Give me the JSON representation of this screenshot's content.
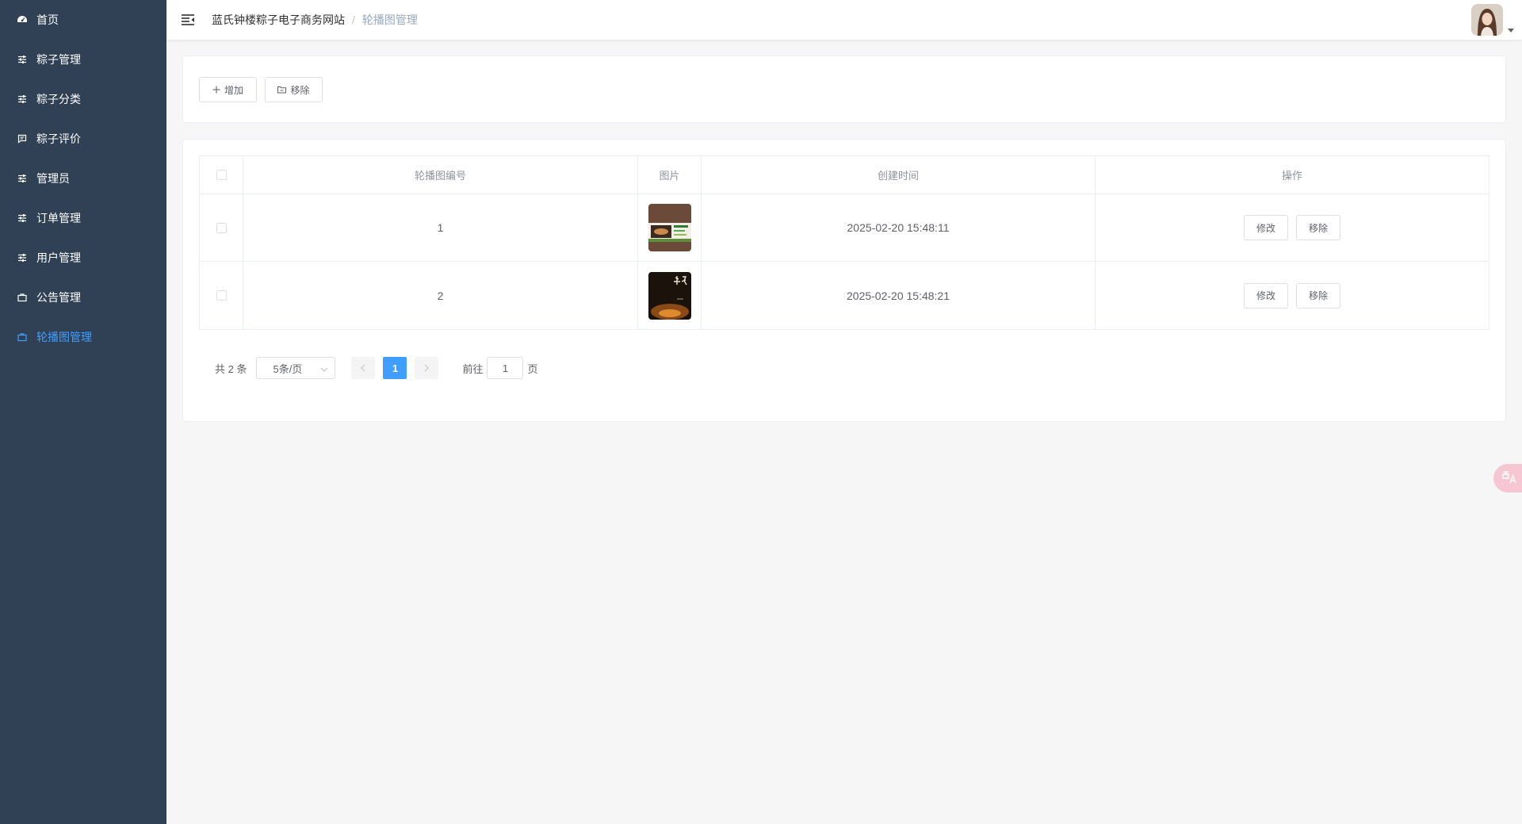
{
  "sidebar": {
    "items": [
      {
        "label": "首页",
        "icon": "dashboard-icon",
        "active": false
      },
      {
        "label": "粽子管理",
        "icon": "sliders-icon",
        "active": false
      },
      {
        "label": "粽子分类",
        "icon": "sliders-icon",
        "active": false
      },
      {
        "label": "粽子评价",
        "icon": "comment-icon",
        "active": false
      },
      {
        "label": "管理员",
        "icon": "sliders-icon",
        "active": false
      },
      {
        "label": "订单管理",
        "icon": "sliders-icon",
        "active": false
      },
      {
        "label": "用户管理",
        "icon": "sliders-icon",
        "active": false
      },
      {
        "label": "公告管理",
        "icon": "briefcase-icon",
        "active": false
      },
      {
        "label": "轮播图管理",
        "icon": "briefcase-icon",
        "active": true
      }
    ],
    "background": "#304156",
    "active_color": "#409eff"
  },
  "header": {
    "breadcrumb_home": "蓝氏钟楼粽子电子商务网站",
    "breadcrumb_separator": "/",
    "breadcrumb_current": "轮播图管理"
  },
  "toolbar": {
    "add_label": "增加",
    "remove_label": "移除"
  },
  "table": {
    "headers": {
      "id": "轮播图编号",
      "image": "图片",
      "created": "创建时间",
      "actions": "操作"
    },
    "rows": [
      {
        "id": "1",
        "created": "2025-02-20 15:48:11",
        "edit": "修改",
        "remove": "移除"
      },
      {
        "id": "2",
        "created": "2025-02-20 15:48:21",
        "edit": "修改",
        "remove": "移除"
      }
    ]
  },
  "pagination": {
    "total_text": "共 2 条",
    "page_size": "5条/页",
    "current_page": "1",
    "jump_prefix": "前往",
    "jump_value": "1",
    "jump_suffix": "页"
  }
}
